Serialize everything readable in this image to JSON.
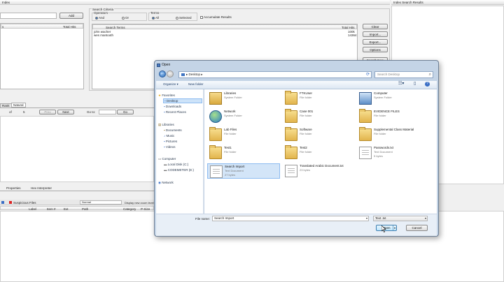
{
  "app": {
    "title": "Index",
    "right_title": "Index Search Results",
    "add_label": "Add",
    "hits_header_left": "s",
    "hits_header_right": "Total Hits",
    "search_criteria": {
      "title": "Search Criteria",
      "operators_label": "Operators",
      "and_label": "And",
      "or_label": "Or",
      "terms_label": "Terms",
      "all_label": "All",
      "selected_label": "Selected",
      "accumulate_label": "Accumulate Results"
    },
    "terms_table": {
      "col_term": "Search Terms",
      "col_hits": "Total Hits",
      "rows": [
        {
          "term": "john wacher",
          "hits": "100k"
        },
        {
          "term": "wes mantooth",
          "hits": "14364"
        }
      ]
    },
    "side_buttons": [
      "Clear",
      "Import...",
      "Export...",
      "Options"
    ],
    "side_button_partial": "Search Now",
    "tabs": [
      "Rank",
      "Natural"
    ],
    "pager": {
      "of": "of",
      "count": "5",
      "prev": "Prev",
      "next": "Next",
      "goto": "Go to:",
      "go": "Go"
    },
    "lower_tabs": [
      "Properties",
      "Hex Interpreter"
    ],
    "suspicious_files": "Suspicious Files",
    "display_mode": "Normal",
    "display_hint": "Display new zoom level",
    "file_cols": [
      "Label",
      "Item #",
      "Ext",
      "Path",
      "Category",
      "P-Size"
    ]
  },
  "dialog": {
    "title": "Open",
    "breadcrumb": "Desktop",
    "search_placeholder": "Search Desktop",
    "organize": "Organize ▾",
    "new_folder": "New folder",
    "nav": {
      "favorites": "Favorites",
      "fav_items": [
        "Desktop",
        "Downloads",
        "Recent Places"
      ],
      "libraries": "Libraries",
      "lib_items": [
        "Documents",
        "Music",
        "Pictures",
        "Videos"
      ],
      "computer": "Computer",
      "comp_items": [
        "Local Disk (C:)",
        "CODEMETER (E:)"
      ],
      "network": "Network"
    },
    "files": [
      {
        "name": "Libraries",
        "type": "System Folder",
        "size": "",
        "icon": "libraries"
      },
      {
        "name": "FTKUser",
        "type": "File folder",
        "size": "",
        "icon": "folder"
      },
      {
        "name": "Computer",
        "type": "System Folder",
        "size": "",
        "icon": "computer"
      },
      {
        "name": "Network",
        "type": "System Folder",
        "size": "",
        "icon": "network"
      },
      {
        "name": "Case 001",
        "type": "File folder",
        "size": "",
        "icon": "folder"
      },
      {
        "name": "EVIDENCE FILES",
        "type": "File folder",
        "size": "",
        "icon": "folder"
      },
      {
        "name": "Lab Files",
        "type": "File folder",
        "size": "",
        "icon": "folder"
      },
      {
        "name": "Software",
        "type": "File folder",
        "size": "",
        "icon": "folder"
      },
      {
        "name": "Supplemental Class Material",
        "type": "File folder",
        "size": "",
        "icon": "folder"
      },
      {
        "name": "Test1",
        "type": "File folder",
        "size": "",
        "icon": "folder"
      },
      {
        "name": "Test2",
        "type": "File folder",
        "size": "",
        "icon": "folder"
      },
      {
        "name": "Passwords.txt",
        "type": "Text Document",
        "size": "5 bytes",
        "icon": "doc"
      },
      {
        "name": "Search Import",
        "type": "Text Document",
        "size": "27 bytes",
        "icon": "doc",
        "selected": true
      },
      {
        "name": "Translated Arabic Document.txt",
        "type": "",
        "size": "23 bytes",
        "icon": "doc"
      }
    ],
    "file_name_label": "File name:",
    "file_name_value": "Search Import",
    "file_type": "Text .txt",
    "open_label": "Open",
    "cancel_label": "Cancel"
  }
}
